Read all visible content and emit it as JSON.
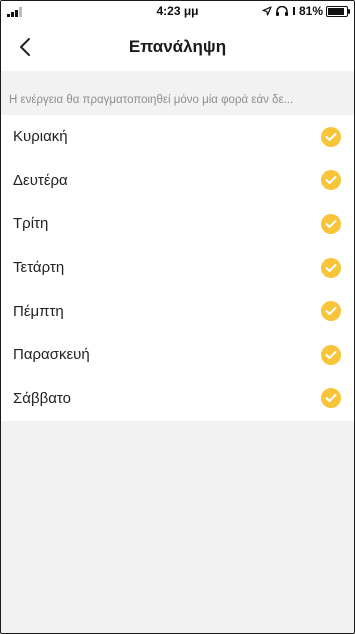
{
  "status_bar": {
    "time": "4:23 μμ",
    "battery": "81%"
  },
  "nav": {
    "title": "Επανάληψη"
  },
  "hint": "Η ενέργεια θα πραγματοποιηθεί μόνο μία φορά εάν δε...",
  "days": [
    {
      "label": "Κυριακή",
      "checked": true
    },
    {
      "label": "Δευτέρα",
      "checked": true
    },
    {
      "label": "Τρίτη",
      "checked": true
    },
    {
      "label": "Τετάρτη",
      "checked": true
    },
    {
      "label": "Πέμπτη",
      "checked": true
    },
    {
      "label": "Παρασκευή",
      "checked": true
    },
    {
      "label": "Σάββατο",
      "checked": true
    }
  ],
  "colors": {
    "accent": "#f7c43a"
  }
}
